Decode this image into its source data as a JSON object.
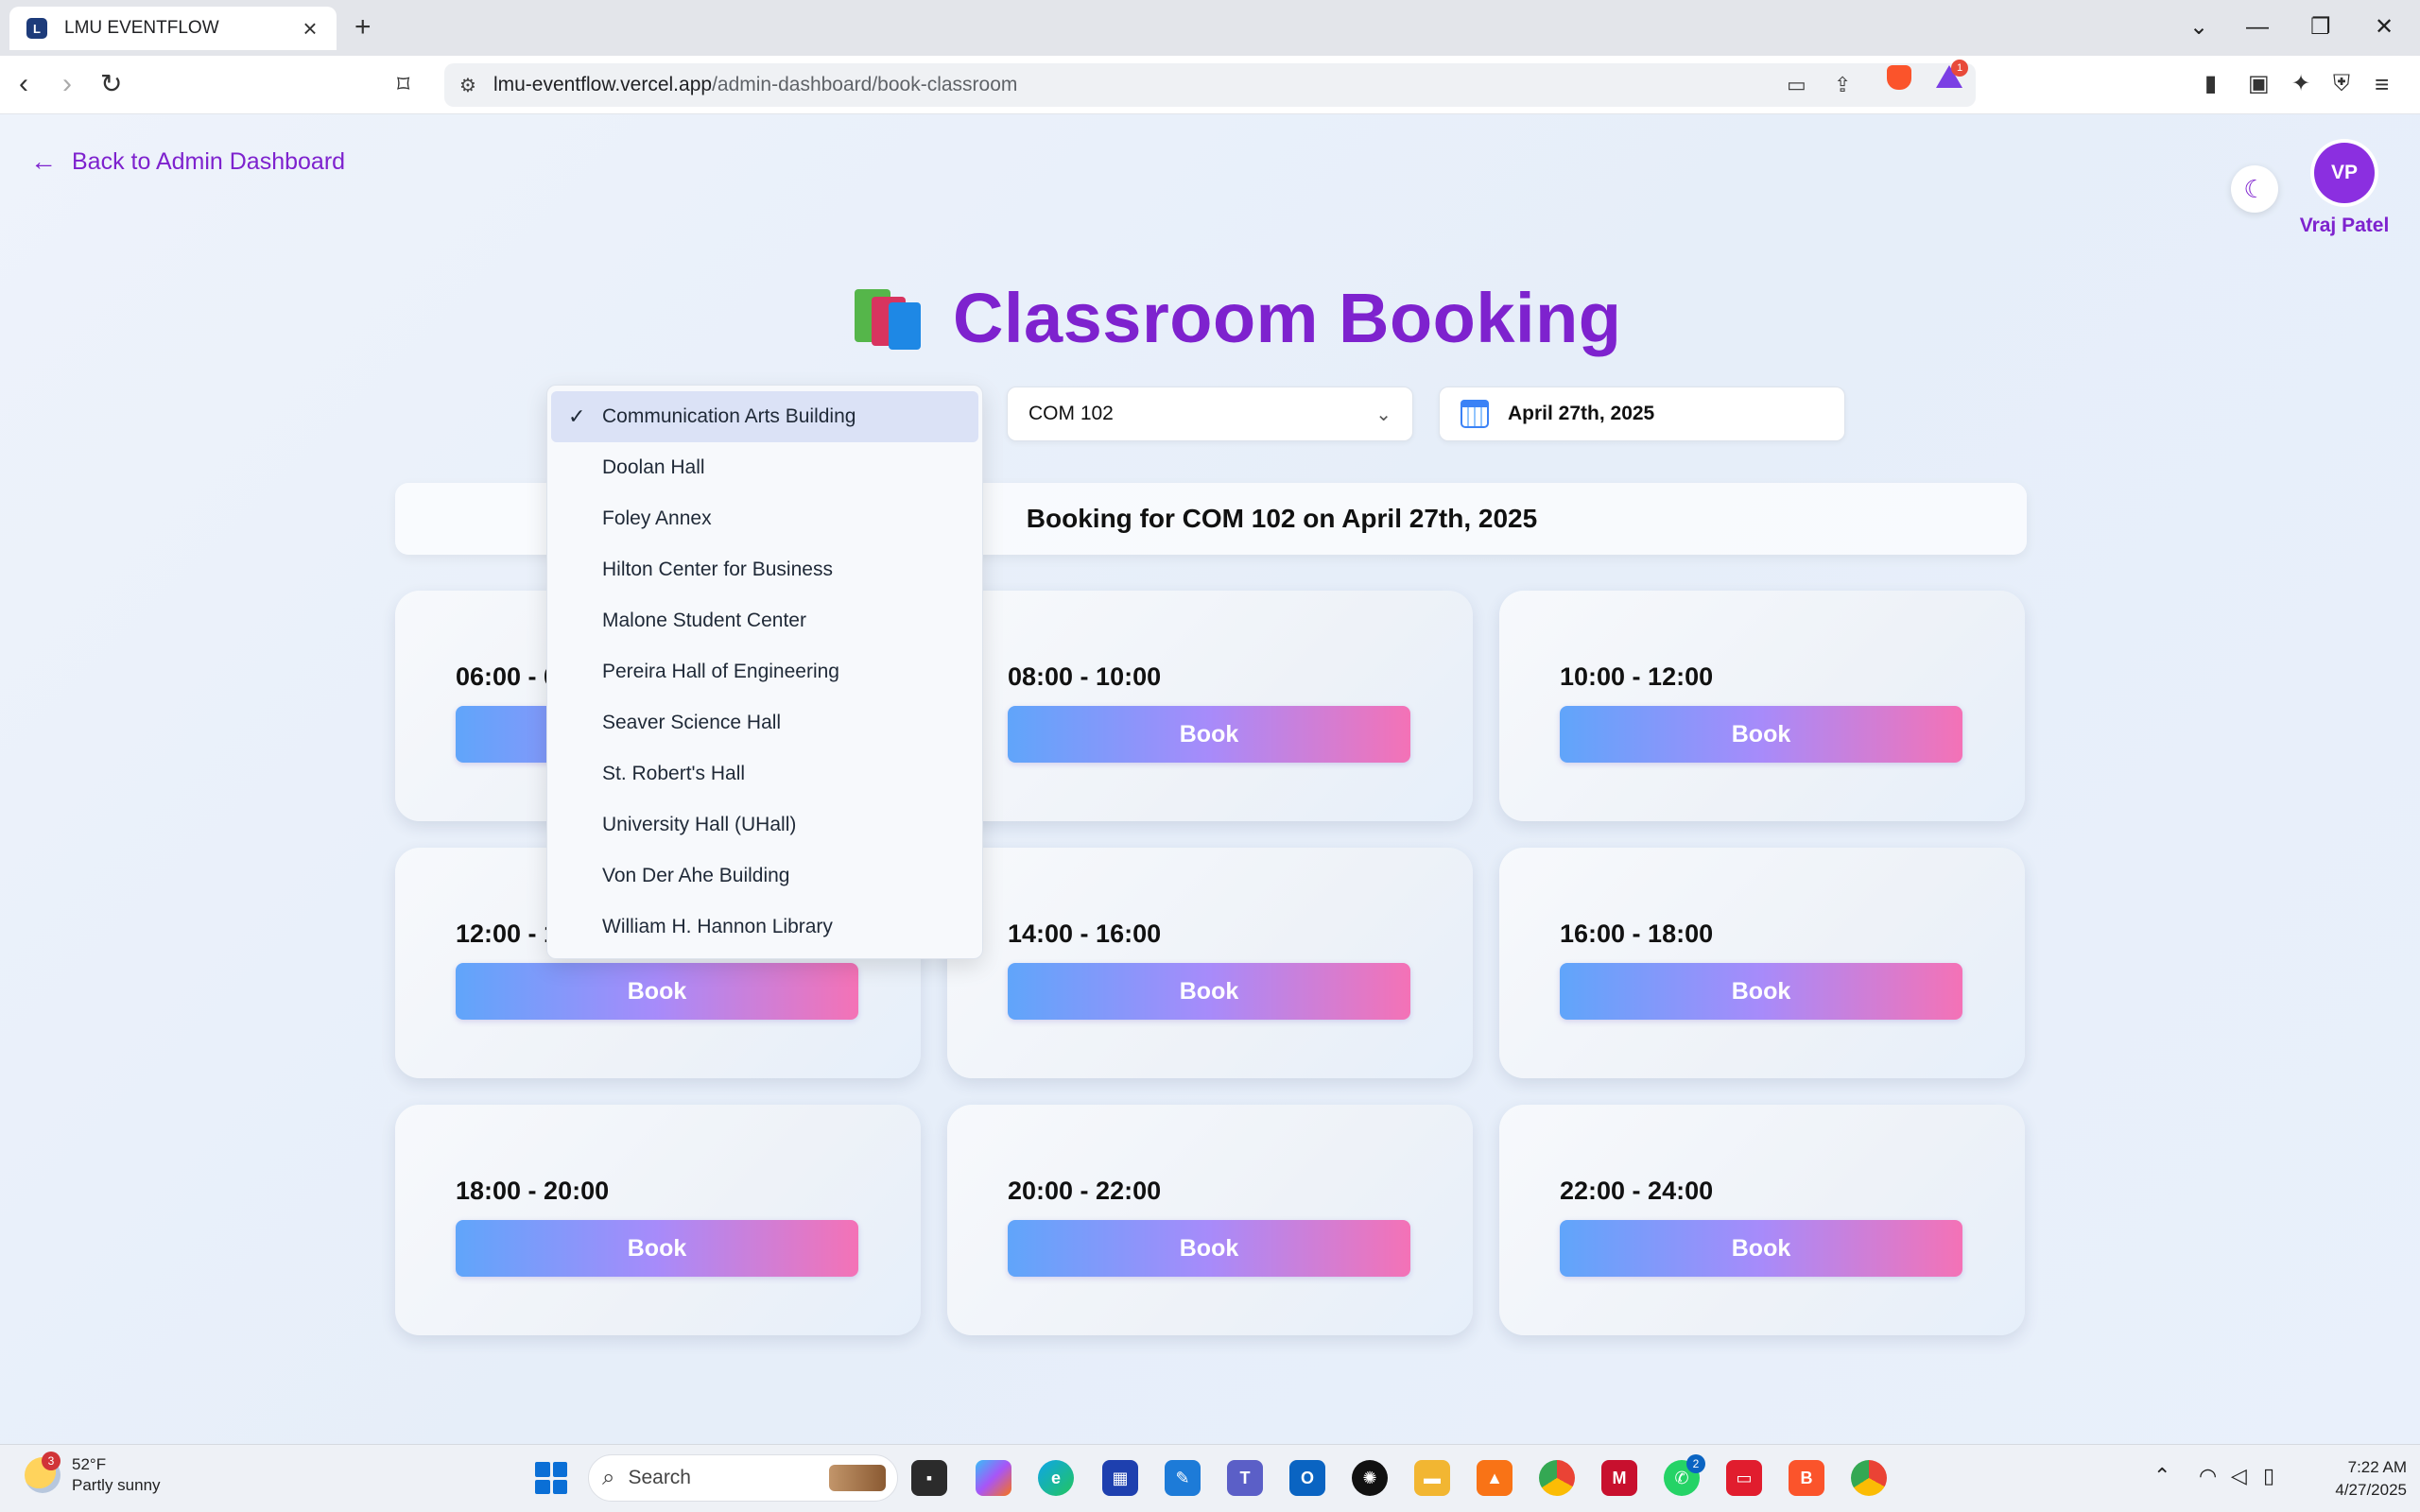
{
  "browser": {
    "tab_title": "LMU EVENTFLOW",
    "url_host": "lmu-eventflow.vercel.app",
    "url_path": "/admin-dashboard/book-classroom",
    "rewards_count": "1"
  },
  "page": {
    "back_link": "Back to Admin Dashboard",
    "title": "Classroom Booking",
    "user": {
      "initials": "VP",
      "name": "Vraj Patel"
    },
    "room_select": "COM 102",
    "date_select": "April 27th, 2025",
    "banner": "Booking for COM 102 on April 27th, 2025",
    "buildings": [
      "Communication Arts Building",
      "Doolan Hall",
      "Foley Annex",
      "Hilton Center for Business",
      "Malone Student Center",
      "Pereira Hall of Engineering",
      "Seaver Science Hall",
      "St. Robert's Hall",
      "University Hall (UHall)",
      "Von Der Ahe Building",
      "William H. Hannon Library"
    ],
    "selected_building": "Communication Arts Building",
    "slots": [
      {
        "time": "06:00 - 08:00",
        "button": "Book"
      },
      {
        "time": "08:00 - 10:00",
        "button": "Book"
      },
      {
        "time": "10:00 - 12:00",
        "button": "Book"
      },
      {
        "time": "12:00 - 14:00",
        "button": "Book"
      },
      {
        "time": "14:00 - 16:00",
        "button": "Book"
      },
      {
        "time": "16:00 - 18:00",
        "button": "Book"
      },
      {
        "time": "18:00 - 20:00",
        "button": "Book"
      },
      {
        "time": "20:00 - 22:00",
        "button": "Book"
      },
      {
        "time": "22:00 - 24:00",
        "button": "Book"
      }
    ],
    "colors": {
      "accent": "#7e22ce",
      "button_from": "#60a5fa",
      "button_to": "#f472b6"
    }
  },
  "taskbar": {
    "weather_temp": "52°F",
    "weather_desc": "Partly sunny",
    "weather_badge": "3",
    "search_placeholder": "Search",
    "whatsapp_badge": "2",
    "time": "7:22 AM",
    "date": "4/27/2025"
  }
}
